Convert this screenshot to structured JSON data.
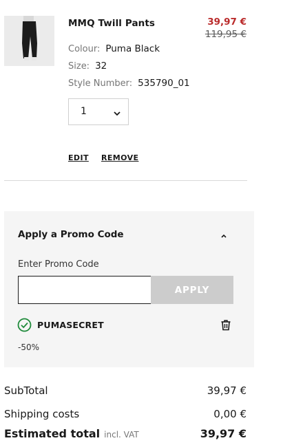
{
  "product": {
    "name": "MMQ Twill Pants",
    "sale_price": "39,97 €",
    "original_price": "119,95 €",
    "colour_label": "Colour:",
    "colour_value": "Puma Black",
    "size_label": "Size:",
    "size_value": "32",
    "style_label": "Style Number:",
    "style_value": "535790_01",
    "quantity": "1",
    "edit_label": "EDIT",
    "remove_label": "REMOVE"
  },
  "promo": {
    "title": "Apply a Promo Code",
    "input_label": "Enter Promo Code",
    "input_value": "",
    "apply_label": "APPLY",
    "applied_code": "PUMASECRET",
    "discount": "-50%"
  },
  "totals": {
    "subtotal_label": "SubTotal",
    "subtotal_value": "39,97 €",
    "shipping_label": "Shipping costs",
    "shipping_value": "0,00 €",
    "estimated_label": "Estimated total",
    "vat_note": "incl. VAT",
    "estimated_value": "39,97 €"
  },
  "colors": {
    "sale": "#ba2b2b",
    "success": "#1e8a3a",
    "disabled_button": "#cccccc"
  },
  "icons": [
    "chevron-down-icon",
    "chevron-up-icon",
    "check-circle-icon",
    "trash-icon"
  ]
}
